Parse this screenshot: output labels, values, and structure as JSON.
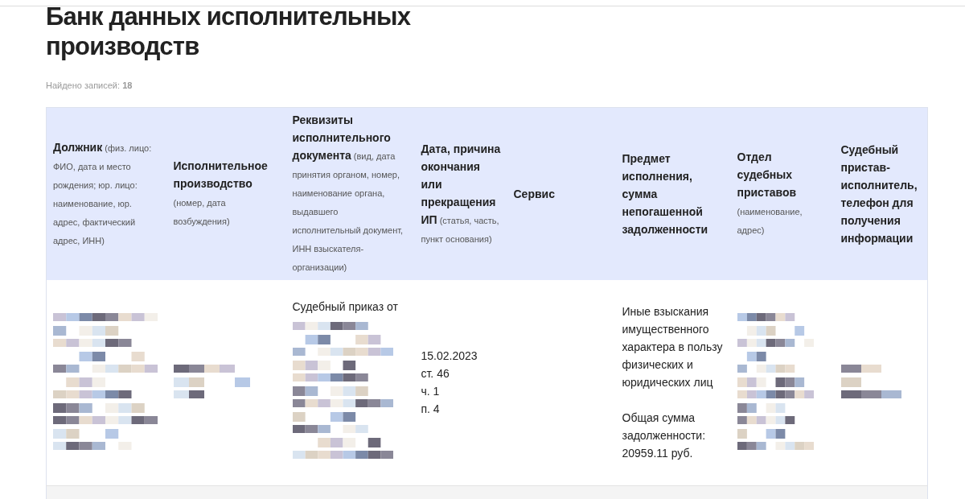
{
  "page": {
    "title": "Банк данных исполнительных производств",
    "found_label": "Найдено записей:",
    "found_count": "18"
  },
  "table": {
    "columns": [
      {
        "title": "Должник",
        "note": "(физ. лицо: ФИО, дата и место рождения; юр. лицо: наименование, юр. адрес, фактический адрес, ИНН)"
      },
      {
        "title": "Исполнительное производство",
        "note": "(номер, дата возбуждения)"
      },
      {
        "title": "Реквизиты исполнительного документа",
        "note": "(вид, дата принятия органом, номер, наименование органа, выдавшего исполнительный документ, ИНН взыскателя-организации)"
      },
      {
        "title": "Дата, причина окончания или прекращения ИП",
        "note": "(статья, часть, пункт основания)"
      },
      {
        "title": "Сервис"
      },
      {
        "title": "Предмет исполнения, сумма непогашенной задолженности"
      },
      {
        "title": "Отдел судебных приставов",
        "note": "(наименование, адрес)"
      },
      {
        "title": "Судебный пристав-исполнитель, телефон для получения информации"
      }
    ],
    "rows": [
      {
        "cells": [
          {
            "parts": [
              {
                "kind": "mosaic"
              }
            ]
          },
          {
            "parts": [
              {
                "kind": "mosaic"
              }
            ]
          },
          {
            "parts": [
              {
                "kind": "text",
                "lines": [
                  "Судебный приказ от"
                ]
              },
              {
                "kind": "mosaic"
              }
            ]
          },
          {
            "parts": [
              {
                "kind": "text",
                "lines": [
                  "15.02.2023",
                  "ст. 46",
                  "ч. 1",
                  "п. 4"
                ]
              }
            ]
          },
          {},
          {
            "parts": [
              {
                "kind": "text",
                "lines": [
                  "Иные взыскания имущественного характера в пользу физических и юридических лиц"
                ]
              },
              {
                "kind": "text",
                "lines": [
                  "Общая сумма задолженности: 20959.11 руб."
                ]
              }
            ]
          },
          {
            "parts": [
              {
                "kind": "mosaic"
              }
            ]
          },
          {
            "parts": [
              {
                "kind": "mosaic"
              }
            ]
          }
        ]
      }
    ]
  }
}
